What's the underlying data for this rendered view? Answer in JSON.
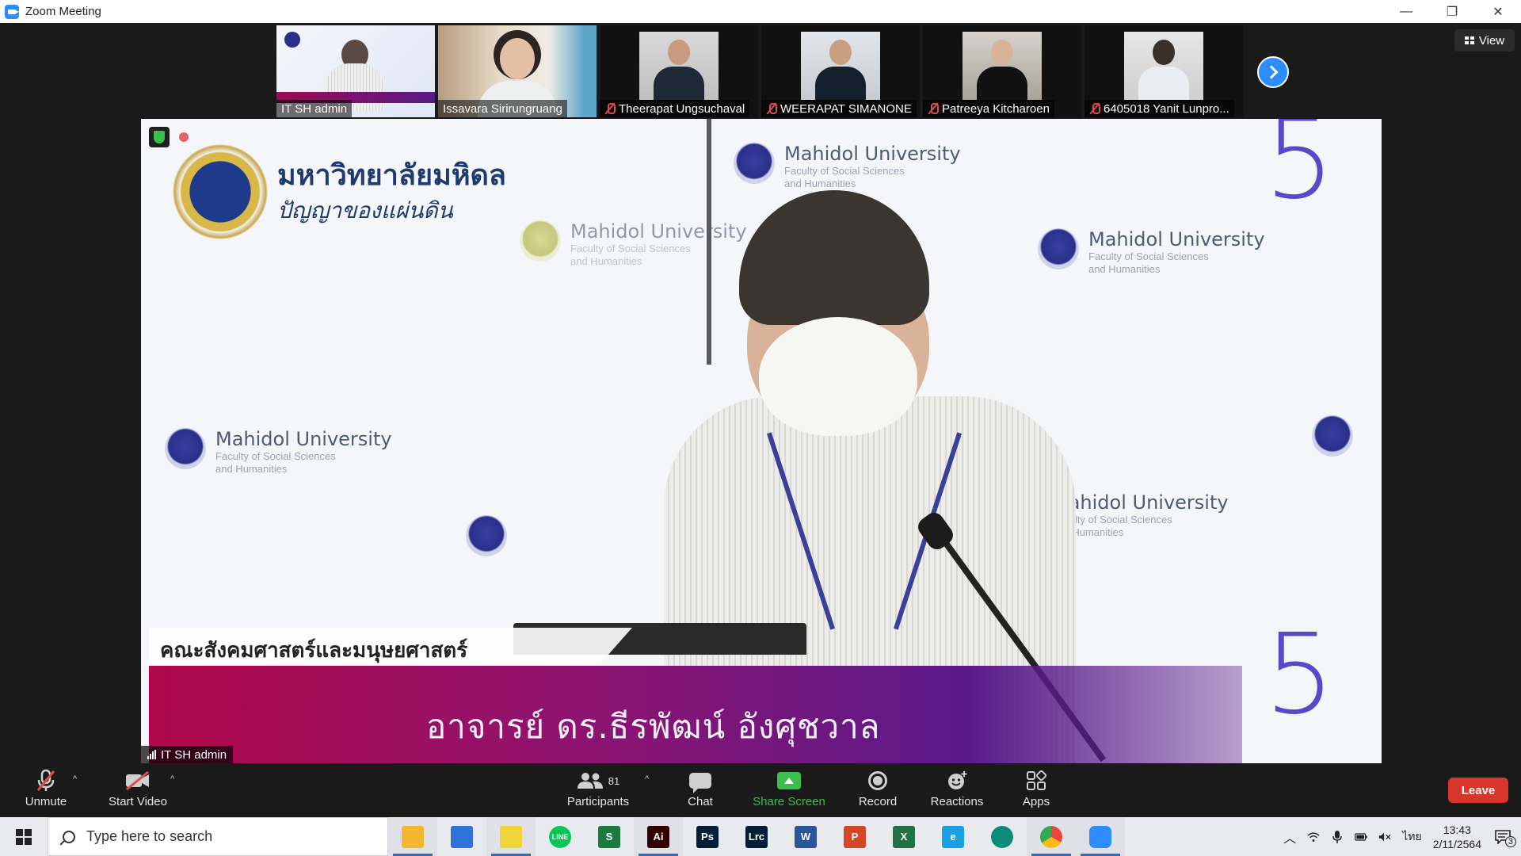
{
  "window": {
    "title": "Zoom Meeting",
    "minimize": "—",
    "restore": "❐",
    "close": "✕"
  },
  "view_button": {
    "label": "View"
  },
  "thumbnails": [
    {
      "name": "IT SH admin",
      "muted": false,
      "active": true
    },
    {
      "name": "Issavara Sirirungruang",
      "muted": false,
      "active": false
    },
    {
      "name": "Theerapat Ungsuchaval",
      "muted": true,
      "active": false
    },
    {
      "name": "WEERAPAT SIMANONE",
      "muted": true,
      "active": false
    },
    {
      "name": "Patreeya Kitcharoen",
      "muted": true,
      "active": false
    },
    {
      "name": "6405018 Yanit Lunpro...",
      "muted": true,
      "active": false
    }
  ],
  "main_video": {
    "speaker": "IT SH admin",
    "brand_thai_title": "มหาวิทยาลัยมหิดล",
    "brand_thai_sub": "ปัญญาของแผ่นดิน",
    "watermark_uni": "Mahidol University",
    "watermark_faculty_1": "Faculty of Social Sciences",
    "watermark_faculty_2": "and Humanities",
    "big_number": "5",
    "lower_third_faculty": "คณะสังคมศาสตร์และมนุษยศาสตร์",
    "lower_third_name": "อาจารย์ ดร.ธีรพัฒน์ อังศุชวาล"
  },
  "toolbar": {
    "unmute": "Unmute",
    "start_video": "Start Video",
    "participants": "Participants",
    "participants_count": "81",
    "chat": "Chat",
    "share_screen": "Share Screen",
    "record": "Record",
    "reactions": "Reactions",
    "apps": "Apps",
    "leave": "Leave",
    "caret": "^"
  },
  "taskbar": {
    "search_placeholder": "Type here to search",
    "apps": [
      {
        "icon": "file-explorer-icon",
        "label": "",
        "color": "#f2b632",
        "open": true
      },
      {
        "icon": "mail-icon",
        "label": "",
        "color": "#2f73d9",
        "open": false
      },
      {
        "icon": "sticky-notes-icon",
        "label": "",
        "color": "#f0d43a",
        "open": true
      },
      {
        "icon": "line-icon",
        "label": "LINE",
        "color": "#06c755",
        "open": false
      },
      {
        "icon": "script-icon",
        "label": "S",
        "color": "#1b7a3c",
        "open": false
      },
      {
        "icon": "illustrator-icon",
        "label": "Ai",
        "color": "#310000",
        "open": true
      },
      {
        "icon": "photoshop-icon",
        "label": "Ps",
        "color": "#001e36",
        "open": false
      },
      {
        "icon": "lightroom-classic-icon",
        "label": "Lrc",
        "color": "#001e36",
        "open": false
      },
      {
        "icon": "word-icon",
        "label": "W",
        "color": "#2b579a",
        "open": false
      },
      {
        "icon": "powerpoint-icon",
        "label": "P",
        "color": "#d24726",
        "open": false
      },
      {
        "icon": "excel-icon",
        "label": "X",
        "color": "#217346",
        "open": false
      },
      {
        "icon": "internet-explorer-icon",
        "label": "e",
        "color": "#1ba1e2",
        "open": false
      },
      {
        "icon": "edge-icon",
        "label": "",
        "color": "#0c8a7a",
        "open": false
      },
      {
        "icon": "chrome-icon",
        "label": "",
        "color": "#e8453c",
        "open": true
      },
      {
        "icon": "zoom-icon",
        "label": "",
        "color": "#2d8cff",
        "open": true
      }
    ],
    "language": "ไทย",
    "time": "13:43",
    "date": "2/11/2564",
    "notifications": "3"
  }
}
